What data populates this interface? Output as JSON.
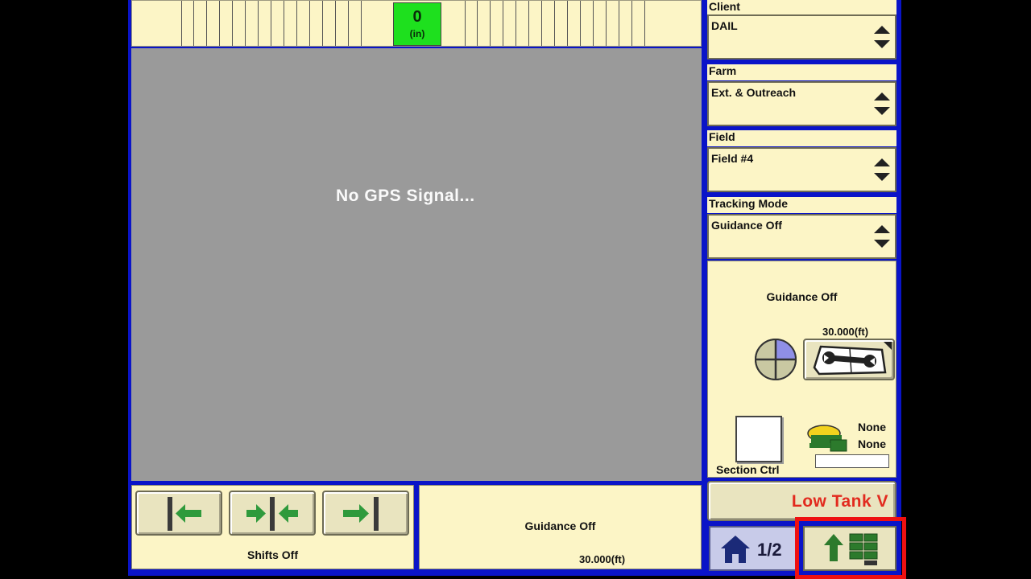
{
  "lightbar": {
    "offset_value": "0",
    "offset_unit": "(in)",
    "left_cells": 14,
    "right_cells": 14
  },
  "map": {
    "message": "No GPS Signal..."
  },
  "shifts": {
    "label": "Shifts Off"
  },
  "guidance_panel": {
    "status": "Guidance Off",
    "width": "30.000(ft)"
  },
  "client": {
    "label": "Client",
    "value": "DAIL"
  },
  "farm": {
    "label": "Farm",
    "value": "Ext. & Outreach"
  },
  "field": {
    "label": "Field",
    "value": "Field #4"
  },
  "tracking_mode": {
    "label": "Tracking Mode",
    "value": "Guidance Off"
  },
  "status_panel": {
    "guidance_status": "Guidance Off",
    "width": "30.000(ft)",
    "section_label": "Section Ctrl",
    "receiver_line1": "None",
    "receiver_line2": "None"
  },
  "alarm": {
    "text": "Low Tank V",
    "color": "#e22a1e"
  },
  "nav": {
    "page_indicator": "1/2"
  },
  "icons": {
    "shift_left": "shift-left-arrow-icon",
    "shift_center": "recenter-arrows-icon",
    "shift_right": "shift-right-arrow-icon",
    "gps_quality": "gps-quality-quadrant-icon",
    "settings": "wrench-book-icon",
    "receiver": "receiver-icon",
    "home": "home-icon",
    "layout": "layout-grid-icon"
  },
  "colors": {
    "screen_border": "#0a14c8",
    "panel_bg": "#fcf5c6",
    "highlight": "#ee1111",
    "lightbar_center": "#1ee01e"
  }
}
